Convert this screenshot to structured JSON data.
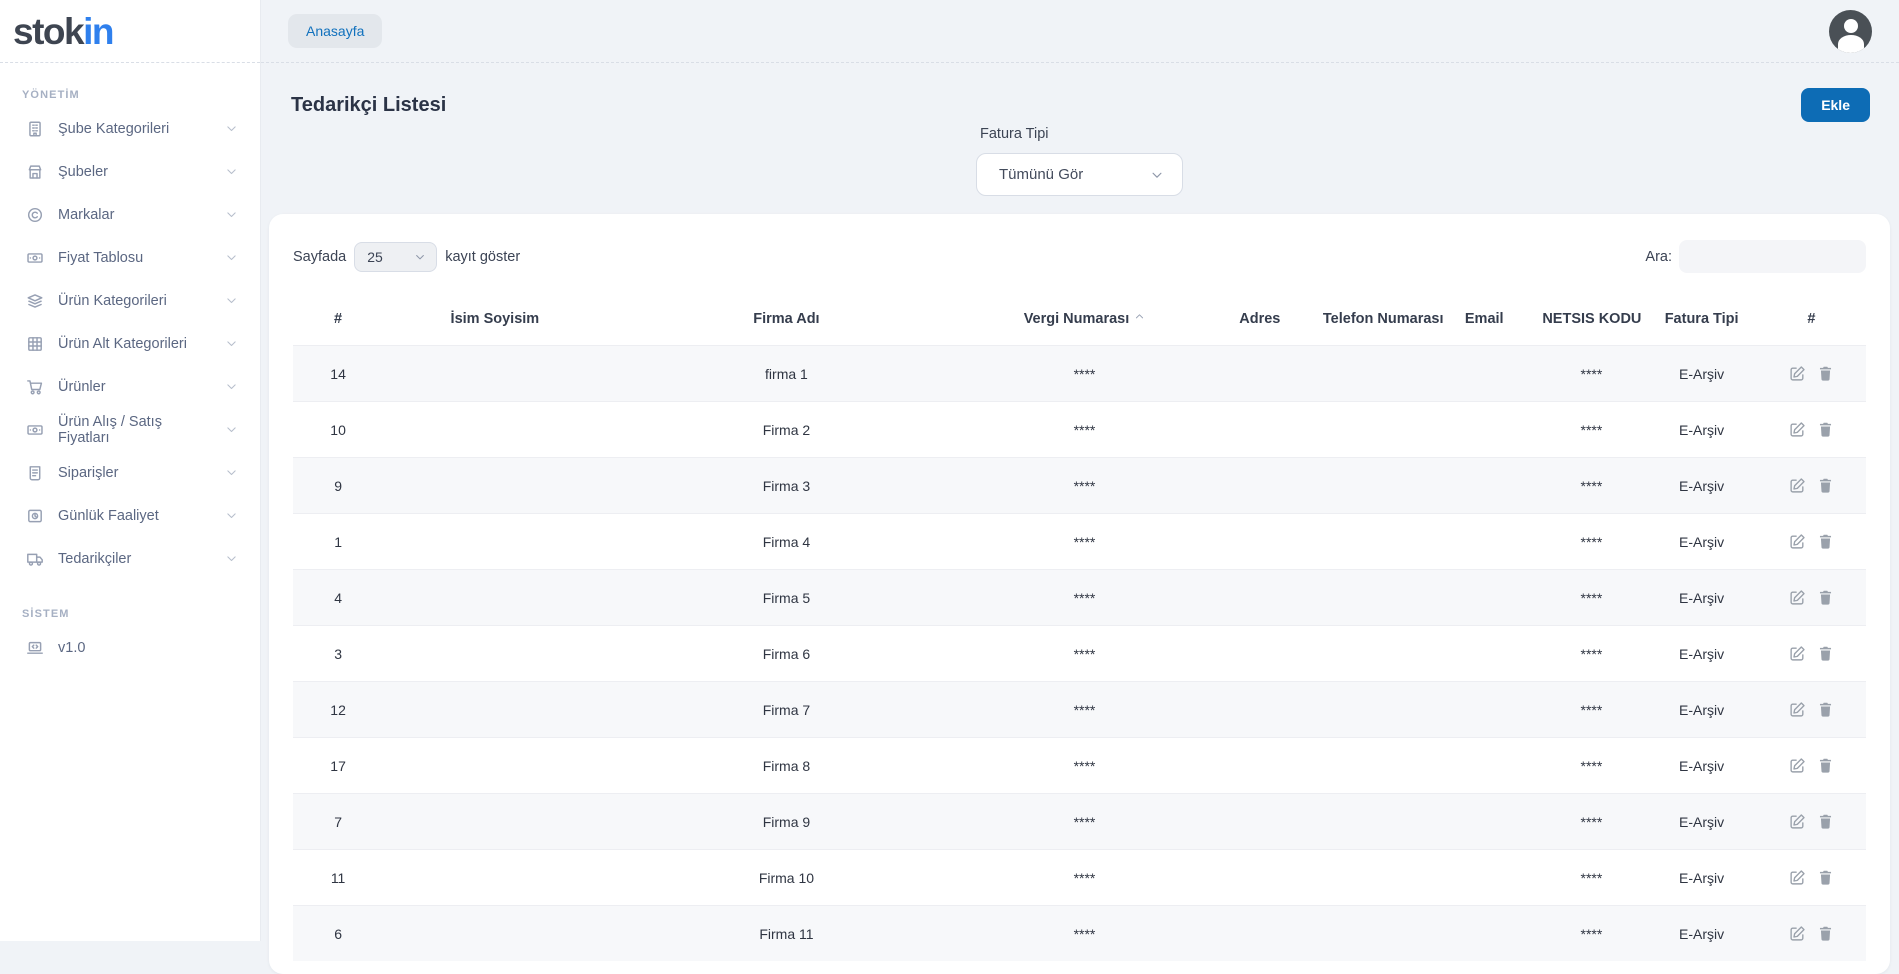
{
  "brand": {
    "logo_stok": "stok",
    "logo_in": "in"
  },
  "topbar": {
    "breadcrumb": "Anasayfa"
  },
  "sidebar": {
    "sections": [
      {
        "label": "YÖNETİM",
        "items": [
          {
            "label": "Şube Kategorileri",
            "icon": "building-icon",
            "chevron": true
          },
          {
            "label": "Şubeler",
            "icon": "store-icon",
            "chevron": true
          },
          {
            "label": "Markalar",
            "icon": "copyright-icon",
            "chevron": true
          },
          {
            "label": "Fiyat Tablosu",
            "icon": "banknote-icon",
            "chevron": true
          },
          {
            "label": "Ürün Kategorileri",
            "icon": "layers-icon",
            "chevron": true
          },
          {
            "label": "Ürün Alt Kategorileri",
            "icon": "grid-icon",
            "chevron": true
          },
          {
            "label": "Ürünler",
            "icon": "cart-icon",
            "chevron": true
          },
          {
            "label": "Ürün Alış / Satış Fiyatları",
            "icon": "banknote-icon",
            "chevron": true
          },
          {
            "label": "Siparişler",
            "icon": "receipt-icon",
            "chevron": true
          },
          {
            "label": "Günlük Faaliyet",
            "icon": "daily-icon",
            "chevron": true
          },
          {
            "label": "Tedarikçiler",
            "icon": "truck-icon",
            "chevron": true
          }
        ]
      },
      {
        "label": "SİSTEM",
        "items": [
          {
            "label": "v1.0",
            "icon": "laptop-icon",
            "chevron": false
          }
        ]
      }
    ]
  },
  "page": {
    "title": "Tedarikçi Listesi",
    "add_button": "Ekle"
  },
  "filter": {
    "label": "Fatura Tipi",
    "selected": "Tümünü Gör"
  },
  "table_controls": {
    "page_length_prefix": "Sayfada",
    "page_length_value": "25",
    "page_length_suffix": "kayıt göster",
    "search_label": "Ara:",
    "search_value": ""
  },
  "table": {
    "columns": [
      "#",
      "İsim Soyisim",
      "Firma Adı",
      "Vergi Numarası",
      "Adres",
      "Telefon Numarası",
      "Email",
      "NETSIS KODU",
      "Fatura Tipi",
      "#"
    ],
    "sorted_column_index": 3,
    "actions": {
      "edit": "edit-icon",
      "delete": "delete-icon"
    },
    "rows": [
      {
        "id": "14",
        "isim": "",
        "firma": "firma 1",
        "vergi": "****",
        "adres": "",
        "telefon": "",
        "email": "",
        "netsis": "****",
        "fatura": "E-Arşiv"
      },
      {
        "id": "10",
        "isim": "",
        "firma": "Firma 2",
        "vergi": "****",
        "adres": "",
        "telefon": "",
        "email": "",
        "netsis": "****",
        "fatura": "E-Arşiv"
      },
      {
        "id": "9",
        "isim": "",
        "firma": "Firma 3",
        "vergi": "****",
        "adres": "",
        "telefon": "",
        "email": "",
        "netsis": "****",
        "fatura": "E-Arşiv"
      },
      {
        "id": "1",
        "isim": "",
        "firma": "Firma 4",
        "vergi": "****",
        "adres": "",
        "telefon": "",
        "email": "",
        "netsis": "****",
        "fatura": "E-Arşiv"
      },
      {
        "id": "4",
        "isim": "",
        "firma": "Firma 5",
        "vergi": "****",
        "adres": "",
        "telefon": "",
        "email": "",
        "netsis": "****",
        "fatura": "E-Arşiv"
      },
      {
        "id": "3",
        "isim": "",
        "firma": "Firma 6",
        "vergi": "****",
        "adres": "",
        "telefon": "",
        "email": "",
        "netsis": "****",
        "fatura": "E-Arşiv"
      },
      {
        "id": "12",
        "isim": "",
        "firma": "Firma 7",
        "vergi": "****",
        "adres": "",
        "telefon": "",
        "email": "",
        "netsis": "****",
        "fatura": "E-Arşiv"
      },
      {
        "id": "17",
        "isim": "",
        "firma": "Firma 8",
        "vergi": "****",
        "adres": "",
        "telefon": "",
        "email": "",
        "netsis": "****",
        "fatura": "E-Arşiv"
      },
      {
        "id": "7",
        "isim": "",
        "firma": "Firma 9",
        "vergi": "****",
        "adres": "",
        "telefon": "",
        "email": "",
        "netsis": "****",
        "fatura": "E-Arşiv"
      },
      {
        "id": "11",
        "isim": "",
        "firma": "Firma 10",
        "vergi": "****",
        "adres": "",
        "telefon": "",
        "email": "",
        "netsis": "****",
        "fatura": "E-Arşiv"
      },
      {
        "id": "6",
        "isim": "",
        "firma": "Firma 11",
        "vergi": "****",
        "adres": "",
        "telefon": "",
        "email": "",
        "netsis": "****",
        "fatura": "E-Arşiv"
      }
    ]
  },
  "colors": {
    "accent_button": "#0d6cb5",
    "breadcrumb_link": "#1171bd",
    "logo_blue": "#2f80ed",
    "logo_dark": "#3e4551",
    "page_background": "#f0f3f7",
    "row_stripe": "#f7f8fa"
  }
}
